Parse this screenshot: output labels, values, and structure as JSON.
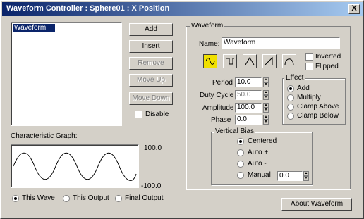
{
  "window": {
    "title": "Waveform Controller : Sphere01 : X Position",
    "close_glyph": "X"
  },
  "list": {
    "items": [
      "Waveform"
    ]
  },
  "side_buttons": {
    "add": "Add",
    "insert": "Insert",
    "remove": "Remove",
    "move_up": "Move Up",
    "move_down": "Move Down",
    "disable": "Disable"
  },
  "graph": {
    "label": "Characteristic Graph:",
    "max": "100.0",
    "min": "-100.0"
  },
  "graph_mode": {
    "this_wave": "This Wave",
    "this_output": "This Output",
    "final_output": "Final Output",
    "selected": "this_wave"
  },
  "waveform": {
    "group_label": "Waveform",
    "name_label": "Name:",
    "name_value": "Waveform",
    "inverted": "Inverted",
    "flipped": "Flipped",
    "shapes": [
      "sine-icon",
      "square-icon",
      "triangle-icon",
      "sawtooth-icon",
      "half-sine-icon"
    ],
    "selected_shape": 0
  },
  "params": {
    "period_label": "Period",
    "period": "10.0",
    "duty_label": "Duty Cycle",
    "duty": "50.0",
    "amplitude_label": "Amplitude",
    "amplitude": "100.0",
    "phase_label": "Phase",
    "phase": "0.0"
  },
  "effect": {
    "group_label": "Effect",
    "add": "Add",
    "multiply": "Multiply",
    "clamp_above": "Clamp Above",
    "clamp_below": "Clamp Below",
    "selected": "add"
  },
  "vertical_bias": {
    "group_label": "Vertical Bias",
    "centered": "Centered",
    "auto_plus": "Auto +",
    "auto_minus": "Auto -",
    "manual": "Manual",
    "manual_value": "0.0",
    "selected": "centered"
  },
  "about_button": "About Waveform",
  "colors": {
    "title_start": "#0a246a",
    "title_end": "#a6caf0",
    "selected_shape": "#f0e000"
  }
}
